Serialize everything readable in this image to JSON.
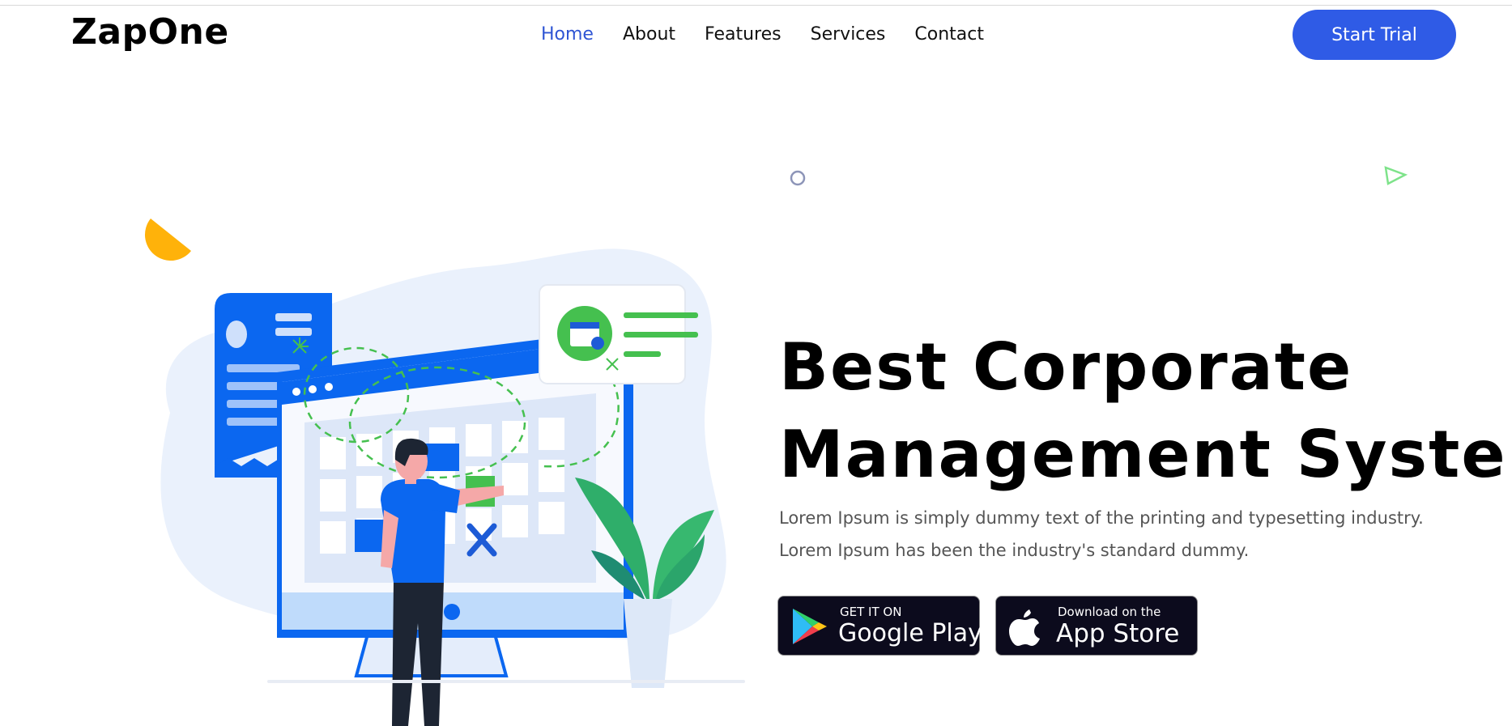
{
  "brand": {
    "name": "ZapOne"
  },
  "nav": {
    "items": [
      {
        "label": "Home",
        "active": true
      },
      {
        "label": "About",
        "active": false
      },
      {
        "label": "Features",
        "active": false
      },
      {
        "label": "Services",
        "active": false
      },
      {
        "label": "Contact",
        "active": false
      }
    ]
  },
  "header": {
    "cta_label": "Start Trial"
  },
  "hero": {
    "title_line1": "Best Corporate",
    "title_line2": "Management System",
    "description": "Lorem Ipsum is simply dummy text of the printing and typesetting industry. Lorem Ipsum has been the industry's standard dummy."
  },
  "stores": {
    "google": {
      "small": "GET IT ON",
      "big": "Google Play",
      "icon": "google-play-icon"
    },
    "apple": {
      "small": "Download on the",
      "big": "App Store",
      "icon": "apple-icon"
    }
  },
  "colors": {
    "accent": "#2f5be6",
    "nav_active": "#2f55d4",
    "store_badge_bg": "#0c0b1d",
    "illustration_blue": "#0b67f0",
    "illustration_green": "#3fc04a"
  }
}
